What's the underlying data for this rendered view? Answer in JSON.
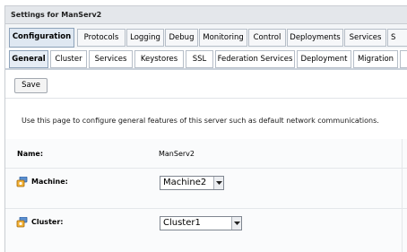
{
  "window": {
    "title": "Settings for ManServ2"
  },
  "primary_tabs": [
    {
      "label": "Configuration",
      "active": true
    },
    {
      "label": "Protocols"
    },
    {
      "label": "Logging"
    },
    {
      "label": "Debug"
    },
    {
      "label": "Monitoring"
    },
    {
      "label": "Control"
    },
    {
      "label": "Deployments"
    },
    {
      "label": "Services"
    },
    {
      "label": "S"
    }
  ],
  "secondary_tabs": [
    {
      "label": "General",
      "active": true
    },
    {
      "label": "Cluster"
    },
    {
      "label": "Services"
    },
    {
      "label": "Keystores"
    },
    {
      "label": "SSL"
    },
    {
      "label": "Federation Services"
    },
    {
      "label": "Deployment"
    },
    {
      "label": "Migration"
    },
    {
      "label": ""
    }
  ],
  "toolbar": {
    "save_label": "Save"
  },
  "description": "Use this page to configure general features of this server such as default network communications.",
  "fields": {
    "name": {
      "label": "Name:",
      "value": "ManServ2"
    },
    "machine": {
      "label": "Machine:",
      "selected": "Machine2",
      "icon": "info-config-icon"
    },
    "cluster": {
      "label": "Cluster:",
      "selected": "Cluster1",
      "icon": "info-config-icon"
    }
  },
  "colors": {
    "title_bar": "#e4e7eb",
    "active_tab": "#dfe8f2",
    "border": "#c9cdd2"
  }
}
